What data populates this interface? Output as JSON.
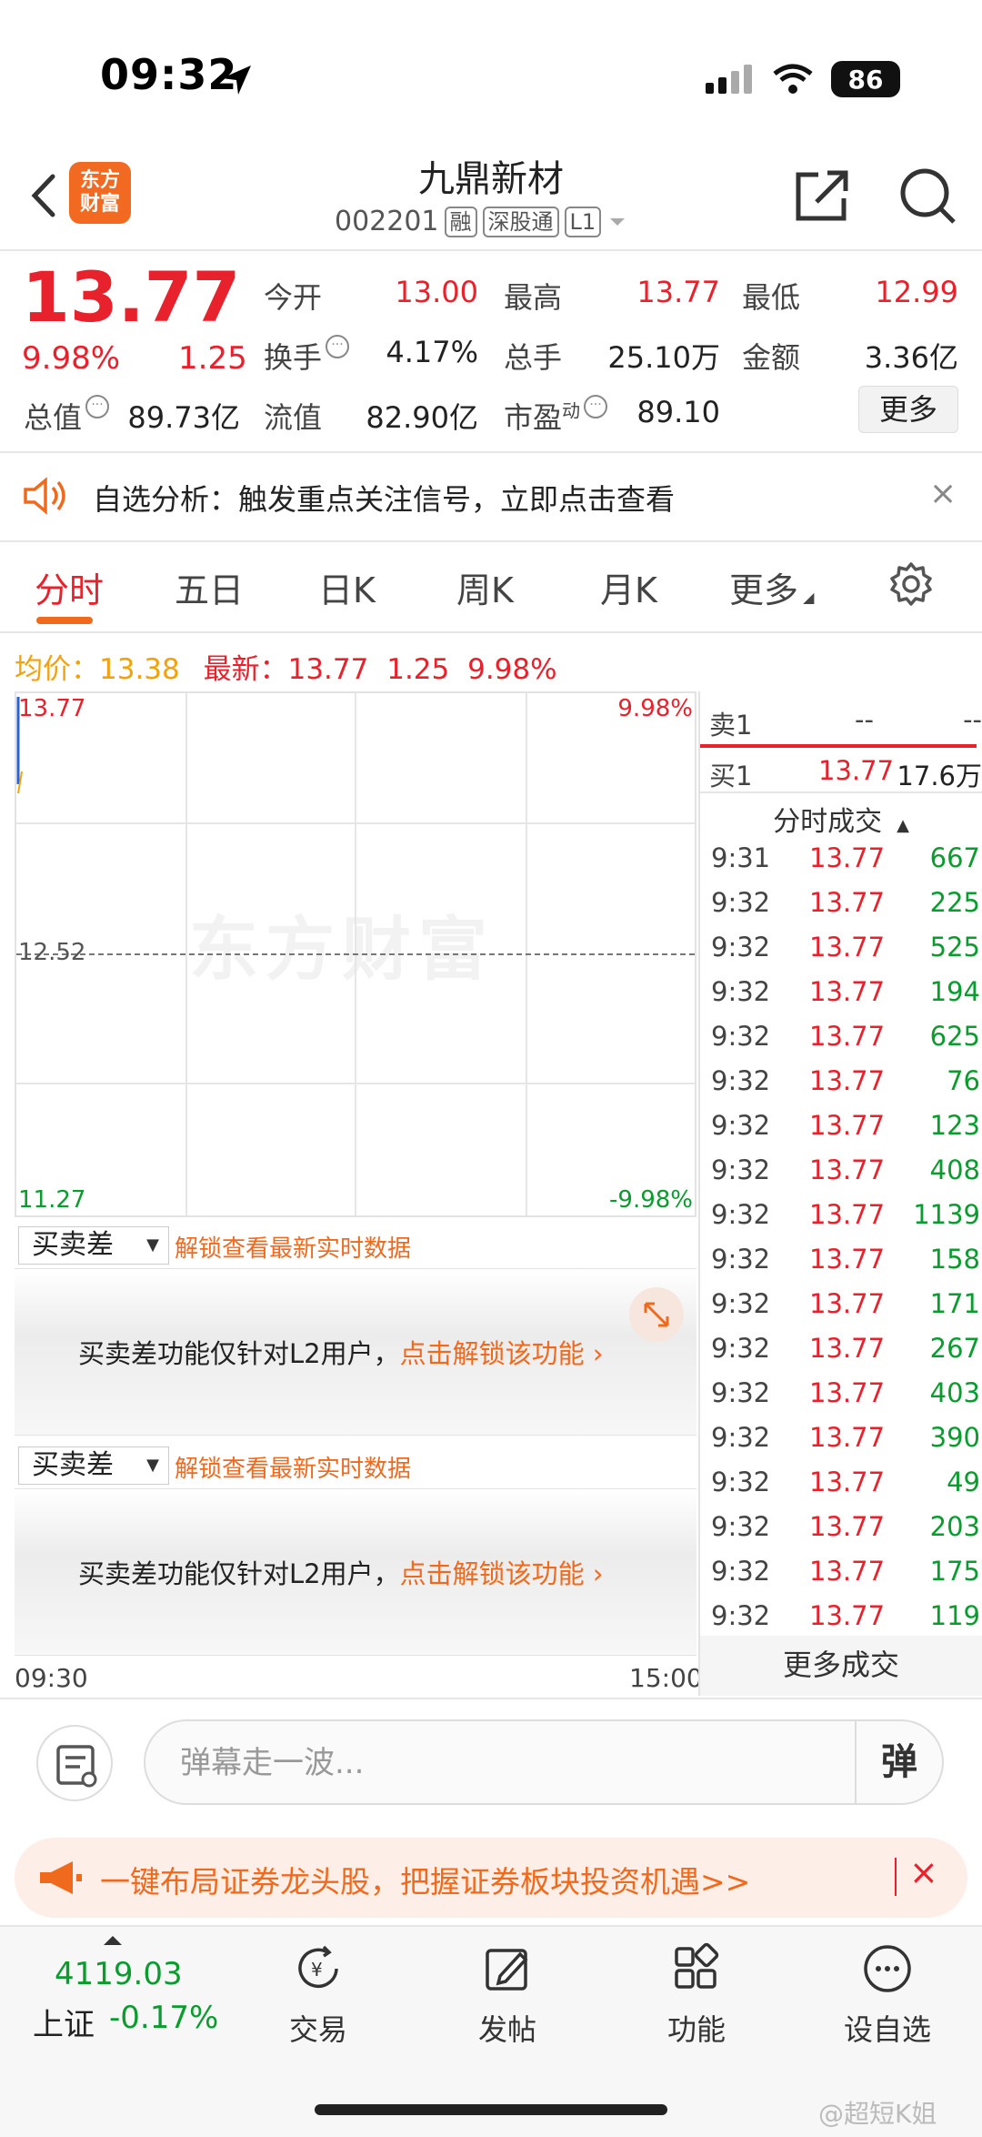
{
  "status": {
    "time": "09:32",
    "battery": "86"
  },
  "header": {
    "logo": "东方财富",
    "logo_line1": "东方",
    "logo_line2": "财富",
    "title": "九鼎新材",
    "code": "002201",
    "tags": [
      "融",
      "深股通",
      "L1"
    ]
  },
  "quote": {
    "price": "13.77",
    "change_pct": "9.98%",
    "change": "1.25",
    "fields": {
      "open_label": "今开",
      "open": "13.00",
      "high_label": "最高",
      "high": "13.77",
      "low_label": "最低",
      "low": "12.99",
      "turnover_label": "换手",
      "turnover": "4.17%",
      "volume_label": "总手",
      "volume": "25.10万",
      "amount_label": "金额",
      "amount": "3.36亿",
      "mcap_label": "总值",
      "mcap": "89.73亿",
      "float_label": "流值",
      "float_cap": "82.90亿",
      "pe_label": "市盈",
      "pe_sup": "动",
      "pe": "89.10"
    },
    "more_label": "更多"
  },
  "notice": {
    "text": "自选分析：触发重点关注信号，立即点击查看",
    "close": "×"
  },
  "tabs": [
    {
      "label": "分时"
    },
    {
      "label": "五日"
    },
    {
      "label": "日K"
    },
    {
      "label": "周K"
    },
    {
      "label": "月K"
    },
    {
      "label": "更多"
    }
  ],
  "stats": {
    "avg_label": "均价：",
    "avg": "13.38",
    "latest_label": "最新：",
    "latest": "13.77",
    "latest_change": "1.25",
    "latest_pct": "9.98%"
  },
  "chart": {
    "top_price": "13.77",
    "top_pct": "9.98%",
    "mid_price": "12.52",
    "bottom_price": "11.27",
    "bottom_pct": "-9.98%",
    "watermark": "东方财富",
    "time_start": "09:30",
    "time_end": "15:00"
  },
  "l2": {
    "select": "买卖差",
    "unlock_hint": "解锁查看最新实时数据",
    "msg": "买卖差功能仅针对L2用户，",
    "link": "点击解锁该功能"
  },
  "orderbook": {
    "sell1_label": "卖1",
    "sell1_price": "--",
    "sell1_vol": "--",
    "buy1_label": "买1",
    "buy1_price": "13.77",
    "buy1_vol": "17.6万",
    "trades_title": "分时成交",
    "trades": [
      {
        "time": "9:31",
        "price": "13.77",
        "vol": "667"
      },
      {
        "time": "9:32",
        "price": "13.77",
        "vol": "225"
      },
      {
        "time": "9:32",
        "price": "13.77",
        "vol": "525"
      },
      {
        "time": "9:32",
        "price": "13.77",
        "vol": "194"
      },
      {
        "time": "9:32",
        "price": "13.77",
        "vol": "625"
      },
      {
        "time": "9:32",
        "price": "13.77",
        "vol": "76"
      },
      {
        "time": "9:32",
        "price": "13.77",
        "vol": "123"
      },
      {
        "time": "9:32",
        "price": "13.77",
        "vol": "408"
      },
      {
        "time": "9:32",
        "price": "13.77",
        "vol": "1139"
      },
      {
        "time": "9:32",
        "price": "13.77",
        "vol": "158"
      },
      {
        "time": "9:32",
        "price": "13.77",
        "vol": "171"
      },
      {
        "time": "9:32",
        "price": "13.77",
        "vol": "267"
      },
      {
        "time": "9:32",
        "price": "13.77",
        "vol": "403"
      },
      {
        "time": "9:32",
        "price": "13.77",
        "vol": "390"
      },
      {
        "time": "9:32",
        "price": "13.77",
        "vol": "49"
      },
      {
        "time": "9:32",
        "price": "13.77",
        "vol": "203"
      },
      {
        "time": "9:32",
        "price": "13.77",
        "vol": "175"
      },
      {
        "time": "9:32",
        "price": "13.77",
        "vol": "119"
      }
    ],
    "more_trades": "更多成交"
  },
  "comment": {
    "placeholder": "弹幕走一波...",
    "send": "弹"
  },
  "promo": {
    "text": "一键布局证券龙头股，把握证券板块投资机遇>>",
    "close": "×"
  },
  "bottom": {
    "index_value": "4119.03",
    "index_name": "上证",
    "index_pct": "-0.17%",
    "nav": [
      {
        "label": "交易"
      },
      {
        "label": "发帖"
      },
      {
        "label": "功能"
      },
      {
        "label": "设自选"
      }
    ]
  },
  "watermark_text": "@超短K姐",
  "colors": {
    "up": "#e8222d",
    "down": "#0b9b2f",
    "accent": "#f06a1e"
  }
}
